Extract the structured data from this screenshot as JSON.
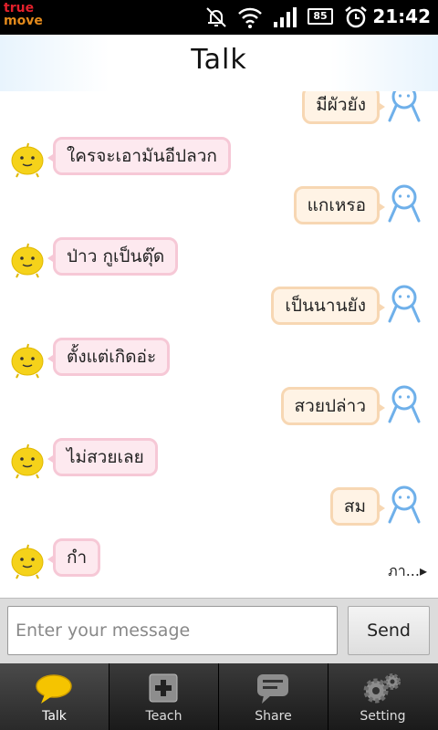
{
  "status_bar": {
    "carrier_line1": "true",
    "carrier_line2": "move",
    "battery": "85",
    "time": "21:42",
    "icons": [
      "mute-icon",
      "wifi-icon",
      "signal-icon",
      "battery-icon",
      "alarm-icon"
    ]
  },
  "header": {
    "title": "Talk"
  },
  "chat": {
    "messages": [
      {
        "from": "user",
        "text": "มีผัวยัง"
      },
      {
        "from": "bot",
        "text": "ใครจะเอามันอีปลวก"
      },
      {
        "from": "user",
        "text": "แกเหรอ"
      },
      {
        "from": "bot",
        "text": "ป่าว กูเป็นตุ๊ด"
      },
      {
        "from": "user",
        "text": "เป็นนานยัง"
      },
      {
        "from": "bot",
        "text": "ตั้งแต่เกิดอ่ะ"
      },
      {
        "from": "user",
        "text": "สวยปล่าว"
      },
      {
        "from": "bot",
        "text": "ไม่สวยเลย"
      },
      {
        "from": "user",
        "text": "สม"
      },
      {
        "from": "bot",
        "text": "กำ"
      }
    ],
    "more_link": "ภา...▸"
  },
  "input": {
    "placeholder": "Enter your message",
    "value": "",
    "send_label": "Send"
  },
  "tabs": [
    {
      "label": "Talk",
      "icon": "chat-bubble-icon",
      "active": true
    },
    {
      "label": "Teach",
      "icon": "plus-icon",
      "active": false
    },
    {
      "label": "Share",
      "icon": "share-bubble-icon",
      "active": false
    },
    {
      "label": "Setting",
      "icon": "gears-icon",
      "active": false
    }
  ],
  "colors": {
    "bot_bubble_bg": "#fde9ef",
    "bot_bubble_border": "#f6c8d6",
    "user_bubble_bg": "#fff3e5",
    "user_bubble_border": "#f7d7b3",
    "tab_bg": "#1a1a1a",
    "active_tab_icon": "#f5c400"
  }
}
